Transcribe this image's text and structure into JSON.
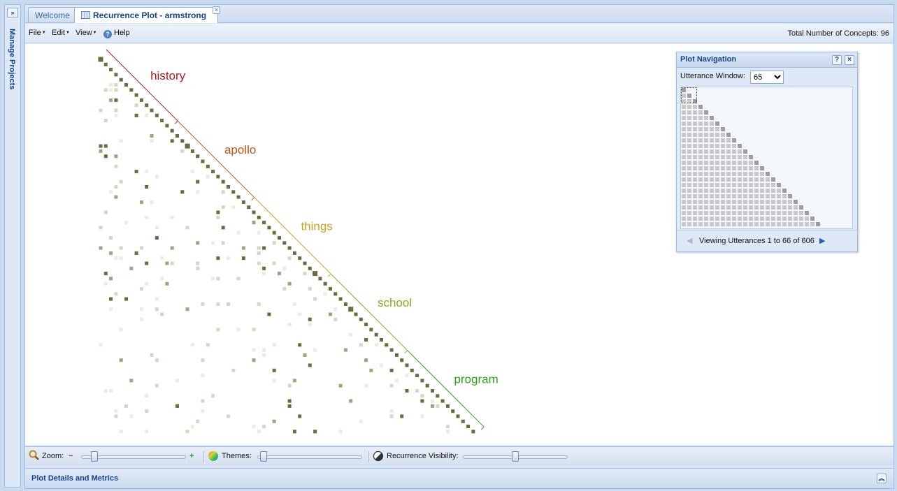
{
  "sidebar": {
    "title": "Manage Projects",
    "expand_icon": "double-chevron-right-icon"
  },
  "tabs": [
    {
      "label": "Welcome",
      "active": false
    },
    {
      "label": "Recurrence Plot - armstrong",
      "active": true,
      "icon": "table-icon",
      "close_icon": "close-icon"
    }
  ],
  "toolbar": {
    "menus": [
      "File",
      "Edit",
      "View"
    ],
    "help": "Help",
    "concepts": "Total Number of Concepts: 96"
  },
  "topics": [
    {
      "label": "history",
      "color": "#b3181e",
      "start": 0,
      "end": 14
    },
    {
      "label": "apollo",
      "color": "#c0561a",
      "start": 14,
      "end": 29
    },
    {
      "label": "things",
      "color": "#c8a51c",
      "start": 29,
      "end": 44
    },
    {
      "label": "school",
      "color": "#7eb21a",
      "start": 44,
      "end": 59
    },
    {
      "label": "program",
      "color": "#2ea21d",
      "start": 59,
      "end": 74
    }
  ],
  "plot_colors": {
    "dark": "#6e6a3c",
    "medium": "#a89f7c",
    "light": "#d9d5c6",
    "faint": "#eceae2"
  },
  "navigation": {
    "title": "Plot Navigation",
    "help_icon": "question-icon",
    "close_icon": "close-icon",
    "window_label": "Utterance Window:",
    "window_value": "65",
    "viewing": "Viewing Utterances 1 to 66 of 606"
  },
  "controls": {
    "zoom_label": "Zoom:",
    "themes_label": "Themes:",
    "visibility_label": "Recurrence Visibility:",
    "zoom_level": 0.1,
    "themes_level": 0.03,
    "visibility_level": 0.5
  },
  "details": {
    "title": "Plot Details and Metrics",
    "toggle_icon": "double-chevron-up-icon"
  }
}
